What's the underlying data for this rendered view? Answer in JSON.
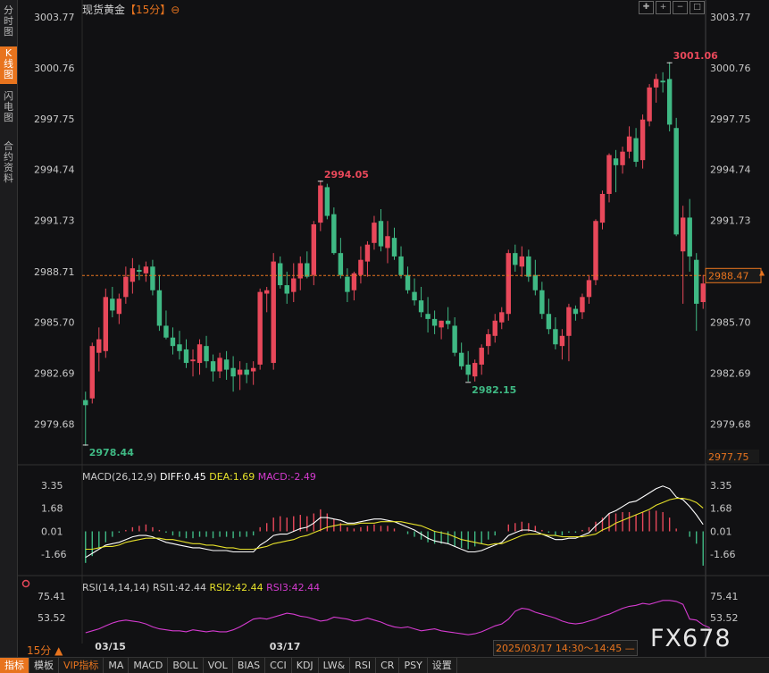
{
  "left_tabs": [
    {
      "label": "分时图",
      "active": false
    },
    {
      "label": "K线图",
      "active": true
    },
    {
      "label": "闪电图",
      "active": false
    },
    {
      "label": "合约资料",
      "active": false
    }
  ],
  "header": {
    "instrument": "现货黄金",
    "period": "【15分】",
    "settings_icon": "gear-icon"
  },
  "toolbar": {
    "icons": [
      "crosshair-icon",
      "zoom-in-icon",
      "zoom-out-icon",
      "square-icon"
    ]
  },
  "price_axis": {
    "ticks": [
      "3003.77",
      "3000.76",
      "2997.75",
      "2994.74",
      "2991.73",
      "2988.71",
      "2985.70",
      "2982.69",
      "2979.68"
    ],
    "current_price": "2988.47",
    "min_label": "2977.75"
  },
  "annotations": {
    "high": "3001.06",
    "low": "2978.44",
    "swing_high": "2994.05",
    "swing_low": "2982.15"
  },
  "macd": {
    "header": "MACD(26,12,9)",
    "diff": "DIFF:0.45",
    "dea": "DEA:1.69",
    "macd": "MACD:-2.49",
    "ticks": [
      "3.35",
      "1.68",
      "0.01",
      "-1.66"
    ]
  },
  "rsi": {
    "header": "RSI(14,14,14)",
    "rsi1": "RSI1:42.44",
    "rsi2": "RSI2:42.44",
    "rsi3": "RSI3:42.44",
    "ticks": [
      "75.41",
      "53.52"
    ]
  },
  "date_labels": [
    "03/15",
    "03/17"
  ],
  "timeframe_label": "15分 ▲",
  "cursor_time": "2025/03/17 14:30～14:45 —",
  "watermark": "FX678",
  "bottom_tabs": [
    {
      "label": "指标",
      "active": true
    },
    {
      "label": "模板",
      "active": false
    },
    {
      "label": "VIP指标",
      "active": false,
      "vip": true
    },
    {
      "label": "MA"
    },
    {
      "label": "MACD"
    },
    {
      "label": "BOLL"
    },
    {
      "label": "VOL"
    },
    {
      "label": "BIAS"
    },
    {
      "label": "CCI"
    },
    {
      "label": "KDJ"
    },
    {
      "label": "LW&"
    },
    {
      "label": "RSI"
    },
    {
      "label": "CR"
    },
    {
      "label": "PSY"
    },
    {
      "label": "设置"
    }
  ],
  "colors": {
    "up": "#e8485a",
    "down": "#3fb984",
    "accent": "#e8741e",
    "diff": "#ffffff",
    "dea": "#e6e12a",
    "rsi": "#d53bd0"
  },
  "chart_data": {
    "type": "candlestick",
    "candles": [
      [
        2981.1,
        2981.6,
        2978.4,
        2980.8
      ],
      [
        2981.2,
        2984.5,
        2980.9,
        2984.3
      ],
      [
        2983.9,
        2985.4,
        2982.8,
        2984.7
      ],
      [
        2984.0,
        2987.7,
        2983.6,
        2987.2
      ],
      [
        2987.1,
        2987.8,
        2986.0,
        2986.4
      ],
      [
        2986.2,
        2987.4,
        2985.6,
        2987.1
      ],
      [
        2987.2,
        2989.0,
        2986.8,
        2988.4
      ],
      [
        2988.1,
        2989.5,
        2987.4,
        2988.9
      ],
      [
        2988.8,
        2989.1,
        2988.2,
        2988.7
      ],
      [
        2988.6,
        2989.3,
        2988.1,
        2989.0
      ],
      [
        2989.0,
        2989.4,
        2987.3,
        2987.6
      ],
      [
        2987.6,
        2988.5,
        2985.2,
        2985.5
      ],
      [
        2985.5,
        2986.4,
        2984.7,
        2984.8
      ],
      [
        2984.8,
        2985.4,
        2983.8,
        2984.3
      ],
      [
        2984.4,
        2985.2,
        2983.5,
        2984.0
      ],
      [
        2984.1,
        2984.7,
        2983.0,
        2983.3
      ],
      [
        2983.4,
        2984.1,
        2982.5,
        2983.5
      ],
      [
        2983.3,
        2984.7,
        2982.6,
        2984.4
      ],
      [
        2984.3,
        2984.9,
        2983.0,
        2983.4
      ],
      [
        2983.4,
        2983.8,
        2982.2,
        2982.8
      ],
      [
        2982.8,
        2983.9,
        2982.4,
        2983.6
      ],
      [
        2983.5,
        2984.0,
        2982.3,
        2982.9
      ],
      [
        2983.0,
        2983.7,
        2981.6,
        2982.5
      ],
      [
        2982.6,
        2983.4,
        2981.7,
        2982.9
      ],
      [
        2982.9,
        2983.3,
        2982.1,
        2982.6
      ],
      [
        2982.8,
        2983.4,
        2982.0,
        2983.0
      ],
      [
        2983.2,
        2987.7,
        2982.9,
        2987.5
      ],
      [
        2987.4,
        2987.8,
        2986.3,
        2987.6
      ],
      [
        2983.3,
        2989.8,
        2982.9,
        2989.3
      ],
      [
        2989.2,
        2989.6,
        2987.7,
        2987.9
      ],
      [
        2987.9,
        2988.7,
        2986.8,
        2987.4
      ],
      [
        2987.5,
        2989.2,
        2986.9,
        2988.3
      ],
      [
        2988.3,
        2989.6,
        2987.6,
        2989.2
      ],
      [
        2989.2,
        2989.9,
        2988.3,
        2988.4
      ],
      [
        2988.5,
        2991.7,
        2987.9,
        2991.5
      ],
      [
        2991.6,
        2994.1,
        2991.1,
        2993.8
      ],
      [
        2993.7,
        2993.9,
        2991.8,
        2992.0
      ],
      [
        2992.1,
        2992.5,
        2989.7,
        2989.8
      ],
      [
        2989.8,
        2990.7,
        2988.3,
        2988.5
      ],
      [
        2988.4,
        2988.9,
        2986.9,
        2987.5
      ],
      [
        2987.6,
        2988.7,
        2987.0,
        2988.6
      ],
      [
        2988.5,
        2990.2,
        2988.0,
        2989.4
      ],
      [
        2989.3,
        2990.5,
        2988.4,
        2990.3
      ],
      [
        2990.4,
        2992.0,
        2990.0,
        2991.6
      ],
      [
        2991.7,
        2992.4,
        2989.9,
        2990.2
      ],
      [
        2990.1,
        2991.7,
        2989.2,
        2990.8
      ],
      [
        2990.7,
        2991.3,
        2989.4,
        2989.6
      ],
      [
        2989.6,
        2990.2,
        2988.3,
        2988.5
      ],
      [
        2988.5,
        2989.0,
        2987.4,
        2987.6
      ],
      [
        2987.5,
        2988.3,
        2986.7,
        2987.0
      ],
      [
        2987.0,
        2987.8,
        2986.0,
        2986.3
      ],
      [
        2986.2,
        2987.2,
        2985.1,
        2985.9
      ],
      [
        2985.9,
        2986.4,
        2985.0,
        2985.5
      ],
      [
        2985.4,
        2985.8,
        2984.7,
        2985.8
      ],
      [
        2985.8,
        2986.6,
        2985.3,
        2985.6
      ],
      [
        2985.5,
        2986.0,
        2983.7,
        2983.9
      ],
      [
        2983.9,
        2984.5,
        2982.9,
        2983.1
      ],
      [
        2983.2,
        2984.0,
        2982.2,
        2982.6
      ],
      [
        2982.5,
        2983.5,
        2982.2,
        2983.3
      ],
      [
        2983.2,
        2984.4,
        2982.6,
        2984.2
      ],
      [
        2984.3,
        2985.3,
        2983.8,
        2985.0
      ],
      [
        2984.9,
        2986.2,
        2984.5,
        2985.8
      ],
      [
        2985.7,
        2986.6,
        2985.3,
        2986.3
      ],
      [
        2986.2,
        2990.0,
        2985.8,
        2989.8
      ],
      [
        2989.8,
        2990.3,
        2988.7,
        2989.1
      ],
      [
        2989.0,
        2990.2,
        2988.4,
        2989.6
      ],
      [
        2989.6,
        2990.0,
        2988.1,
        2988.4
      ],
      [
        2988.5,
        2989.4,
        2987.3,
        2987.6
      ],
      [
        2987.6,
        2988.1,
        2985.9,
        2986.2
      ],
      [
        2986.2,
        2987.1,
        2985.0,
        2985.3
      ],
      [
        2985.3,
        2986.0,
        2984.1,
        2984.4
      ],
      [
        2984.3,
        2985.3,
        2983.5,
        2984.9
      ],
      [
        2984.9,
        2986.8,
        2983.4,
        2986.6
      ],
      [
        2986.5,
        2986.7,
        2985.8,
        2986.2
      ],
      [
        2986.3,
        2987.4,
        2985.9,
        2987.2
      ],
      [
        2987.2,
        2988.5,
        2986.8,
        2988.2
      ],
      [
        2988.2,
        2991.8,
        2987.9,
        2991.7
      ],
      [
        2991.6,
        2993.5,
        2991.2,
        2993.3
      ],
      [
        2993.3,
        2995.7,
        2992.8,
        2995.6
      ],
      [
        2995.4,
        2995.9,
        2993.4,
        2995.0
      ],
      [
        2995.0,
        2996.1,
        2994.5,
        2995.8
      ],
      [
        2995.8,
        2997.3,
        2995.4,
        2996.7
      ],
      [
        2996.6,
        2997.2,
        2994.9,
        2995.2
      ],
      [
        2995.3,
        2998.0,
        2994.8,
        2997.7
      ],
      [
        2997.6,
        2999.8,
        2997.3,
        2999.6
      ],
      [
        2999.6,
        3000.4,
        2998.7,
        3000.1
      ],
      [
        3000.0,
        3000.5,
        2999.3,
        2999.9
      ],
      [
        3000.1,
        3001.1,
        2997.0,
        2997.4
      ],
      [
        2997.2,
        2997.8,
        2990.8,
        2990.9
      ],
      [
        2989.9,
        2992.6,
        2986.8,
        2991.9
      ],
      [
        2991.9,
        2993.0,
        2988.7,
        2989.6
      ],
      [
        2989.4,
        2989.8,
        2985.2,
        2986.8
      ],
      [
        2986.9,
        2988.5,
        2986.5,
        2988.0
      ]
    ],
    "macd": {
      "histogram": [
        -2.3,
        -1.8,
        -1.2,
        -0.8,
        -0.4,
        -0.1,
        0.1,
        0.3,
        0.4,
        0.5,
        0.3,
        0.1,
        -0.1,
        -0.3,
        -0.4,
        -0.5,
        -0.5,
        -0.4,
        -0.4,
        -0.5,
        -0.4,
        -0.4,
        -0.5,
        -0.4,
        -0.4,
        -0.3,
        0.3,
        0.6,
        1.0,
        1.1,
        1.0,
        1.1,
        1.2,
        1.1,
        1.3,
        1.6,
        1.3,
        0.9,
        0.6,
        0.3,
        0.2,
        0.3,
        0.4,
        0.5,
        0.4,
        0.4,
        0.2,
        0.0,
        -0.2,
        -0.4,
        -0.6,
        -0.8,
        -0.9,
        -0.9,
        -0.9,
        -1.1,
        -1.2,
        -1.3,
        -1.1,
        -0.9,
        -0.6,
        -0.3,
        0.0,
        0.5,
        0.6,
        0.7,
        0.6,
        0.4,
        0.1,
        -0.1,
        -0.3,
        -0.3,
        -0.1,
        -0.1,
        0.1,
        0.3,
        0.7,
        1.0,
        1.3,
        1.3,
        1.4,
        1.4,
        1.2,
        1.4,
        1.5,
        1.5,
        1.4,
        1.0,
        0.2,
        0.0,
        -0.4,
        -0.9,
        -2.5
      ],
      "diff": [
        -1.9,
        -1.6,
        -1.3,
        -1.0,
        -0.9,
        -0.8,
        -0.6,
        -0.4,
        -0.3,
        -0.3,
        -0.4,
        -0.6,
        -0.8,
        -0.9,
        -1.0,
        -1.1,
        -1.2,
        -1.2,
        -1.3,
        -1.4,
        -1.4,
        -1.4,
        -1.5,
        -1.5,
        -1.5,
        -1.5,
        -1.0,
        -0.7,
        -0.3,
        -0.2,
        -0.2,
        0.0,
        0.2,
        0.3,
        0.6,
        1.0,
        1.0,
        0.9,
        0.8,
        0.6,
        0.6,
        0.7,
        0.8,
        0.9,
        0.9,
        0.8,
        0.7,
        0.5,
        0.3,
        0.1,
        -0.2,
        -0.5,
        -0.7,
        -0.8,
        -0.9,
        -1.1,
        -1.3,
        -1.5,
        -1.5,
        -1.4,
        -1.2,
        -1.0,
        -0.8,
        -0.3,
        -0.1,
        0.1,
        0.1,
        0.0,
        -0.2,
        -0.4,
        -0.6,
        -0.6,
        -0.5,
        -0.5,
        -0.3,
        -0.1,
        0.4,
        0.8,
        1.3,
        1.5,
        1.8,
        2.1,
        2.2,
        2.5,
        2.8,
        3.1,
        3.3,
        3.1,
        2.5,
        2.3,
        1.8,
        1.2,
        0.5
      ],
      "dea": [
        -1.3,
        -1.3,
        -1.2,
        -1.1,
        -1.1,
        -1.0,
        -0.8,
        -0.7,
        -0.6,
        -0.5,
        -0.5,
        -0.5,
        -0.6,
        -0.6,
        -0.7,
        -0.8,
        -0.9,
        -0.9,
        -1.0,
        -1.0,
        -1.1,
        -1.2,
        -1.2,
        -1.3,
        -1.3,
        -1.3,
        -1.2,
        -1.1,
        -0.9,
        -0.8,
        -0.7,
        -0.6,
        -0.4,
        -0.3,
        -0.1,
        0.1,
        0.3,
        0.4,
        0.5,
        0.5,
        0.5,
        0.6,
        0.6,
        0.6,
        0.7,
        0.7,
        0.7,
        0.7,
        0.6,
        0.5,
        0.4,
        0.2,
        0.0,
        -0.1,
        -0.2,
        -0.4,
        -0.6,
        -0.7,
        -0.8,
        -0.9,
        -1.0,
        -0.9,
        -0.9,
        -0.7,
        -0.5,
        -0.3,
        -0.2,
        -0.2,
        -0.2,
        -0.3,
        -0.3,
        -0.4,
        -0.4,
        -0.4,
        -0.4,
        -0.3,
        -0.2,
        0.1,
        0.3,
        0.6,
        0.8,
        1.0,
        1.2,
        1.4,
        1.6,
        1.9,
        2.1,
        2.3,
        2.4,
        2.4,
        2.3,
        2.1,
        1.7
      ]
    },
    "rsi": [
      38,
      40,
      42,
      45,
      48,
      50,
      51,
      50,
      49,
      47,
      44,
      42,
      41,
      40,
      40,
      39,
      41,
      40,
      39,
      40,
      39,
      39,
      41,
      44,
      48,
      52,
      53,
      52,
      54,
      56,
      58,
      57,
      55,
      54,
      52,
      50,
      51,
      54,
      53,
      52,
      50,
      51,
      53,
      51,
      49,
      46,
      44,
      43,
      44,
      42,
      40,
      41,
      42,
      40,
      39,
      38,
      37,
      36,
      37,
      39,
      42,
      45,
      47,
      52,
      60,
      63,
      62,
      59,
      57,
      55,
      53,
      50,
      48,
      47,
      48,
      50,
      52,
      55,
      57,
      60,
      63,
      65,
      66,
      68,
      67,
      69,
      71,
      71,
      70,
      67,
      52,
      51,
      46,
      43
    ],
    "ylim": [
      2977.75,
      3003.77
    ]
  }
}
